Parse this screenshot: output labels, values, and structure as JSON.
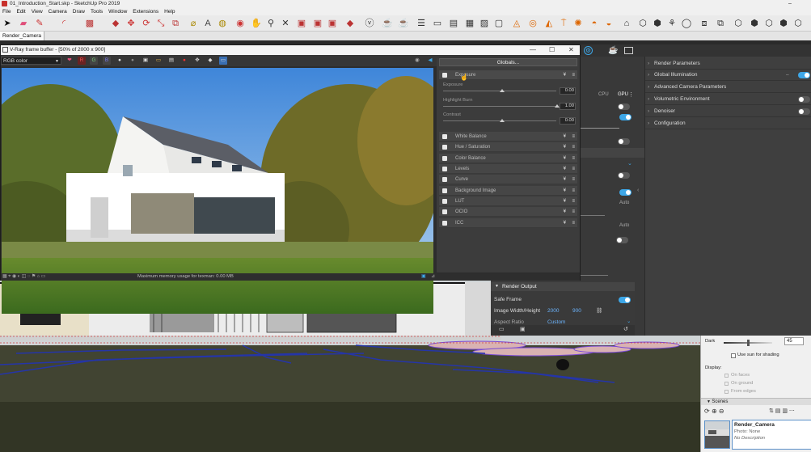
{
  "sketchup": {
    "title": "01_Introduction_Start.skp - SketchUp Pro 2019",
    "menu": [
      "File",
      "Edit",
      "View",
      "Camera",
      "Draw",
      "Tools",
      "Window",
      "Extensions",
      "Help"
    ],
    "scene_tab": "Render_Camera"
  },
  "framebuffer": {
    "title": "V-Ray frame buffer - [50% of 2000 x 900]",
    "channel": "RGB color",
    "channel_buttons": [
      "R",
      "G",
      "B"
    ],
    "status": "Maximum memory usage for texman: 0.00 MB",
    "corrections": {
      "globals_label": "Globals...",
      "exposure": {
        "label": "Exposure",
        "sliders": [
          {
            "label": "Exposure",
            "value": "0.00"
          },
          {
            "label": "Highlight Burn",
            "value": "1.00"
          },
          {
            "label": "Contrast",
            "value": "0.00"
          }
        ]
      },
      "layers": [
        "White Balance",
        "Hue / Saturation",
        "Color Balance",
        "Levels",
        "Curve",
        "Background Image",
        "LUT",
        "OCIO",
        "ICC"
      ]
    }
  },
  "asset_editor": {
    "sections": [
      "Render Parameters",
      "Global Illumination",
      "Advanced Camera Parameters",
      "Volumetric Environment",
      "Denoiser",
      "Configuration"
    ],
    "cpu_label": "CPU",
    "gpu_label": "GPU",
    "auto_label": "Auto",
    "render_output": {
      "header": "Render Output",
      "safe_frame_label": "Safe Frame",
      "size_label": "Image Width/Height",
      "width": "2000",
      "height": "900",
      "aspect_label": "Aspect Ratio",
      "aspect_value": "Custom"
    }
  },
  "shadows": {
    "dark_label": "Dark",
    "dark_value": "45",
    "use_sun_label": "Use sun for shading",
    "display_label": "Display:",
    "display_options": [
      "On faces",
      "On ground",
      "From edges"
    ],
    "scenes_label": "Scenes",
    "scene": {
      "name": "Render_Camera",
      "photo": "Photo: None",
      "description": "No Description"
    }
  },
  "colors": {
    "accent": "#3da7e8",
    "sky": "#7fb6e3",
    "grass": "#4f7a2a"
  }
}
